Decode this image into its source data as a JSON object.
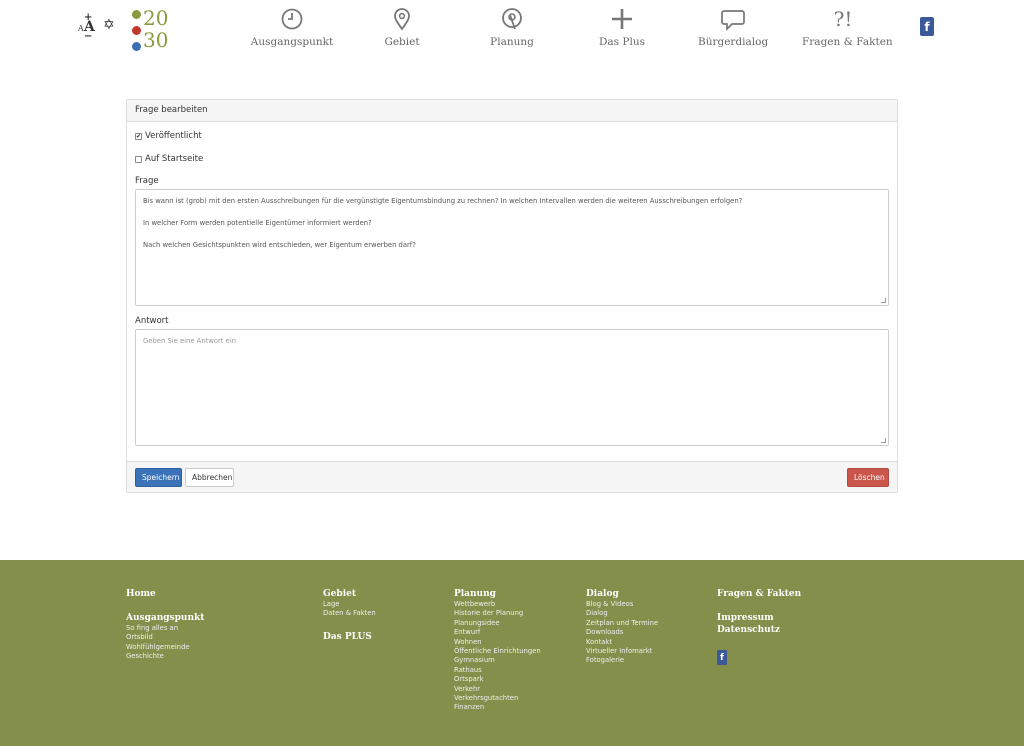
{
  "header": {
    "accessibility": {
      "plus": "+",
      "small_a": "A",
      "big_a": "A",
      "minus": "−"
    },
    "contrast_symbol": "✡",
    "logo": {
      "top": "20",
      "bottom": "30"
    },
    "nav": [
      {
        "label": "Ausgangspunkt",
        "icon": "clock-icon"
      },
      {
        "label": "Gebiet",
        "icon": "map-pin-icon"
      },
      {
        "label": "Planung",
        "icon": "compass-icon"
      },
      {
        "label": "Das Plus",
        "icon": "plus-icon"
      },
      {
        "label": "Bürgerdialog",
        "icon": "speech-bubble-icon"
      },
      {
        "label": "Fragen & Fakten",
        "icon": "question-exclamation-icon",
        "glyph": "?!"
      }
    ],
    "facebook": "f"
  },
  "form": {
    "heading": "Frage bearbeiten",
    "published": {
      "label": "Veröffentlicht",
      "checked": true,
      "mark": "✔"
    },
    "homepage": {
      "label": "Auf Startseite",
      "checked": false
    },
    "question": {
      "label": "Frage",
      "lines": [
        "Bis wann ist (grob) mit den ersten Ausschreibungen für die vergünstigte Eigentumsbindung zu rechnen? In welchen Intervallen werden die weiteren Ausschreibungen erfolgen?",
        "In welcher Form werden potentielle Eigentümer informiert werden?",
        "Nach welchen Gesichtspunkten wird entschieden, wer Eigentum erwerben darf?"
      ]
    },
    "answer": {
      "label": "Antwort",
      "placeholder": "Geben Sie eine Antwort ein"
    },
    "buttons": {
      "save": "Speichern",
      "cancel": "Abbrechen",
      "delete": "Löschen"
    }
  },
  "footer": {
    "col1": {
      "home": "Home",
      "title": "Ausgangspunkt",
      "links": [
        "So fing alles an",
        "Ortsbild",
        "Wohlfühlgemeinde",
        "Geschichte"
      ]
    },
    "col2": {
      "title": "Gebiet",
      "links": [
        "Lage",
        "Daten & Fakten"
      ],
      "plus": "Das PLUS"
    },
    "col3": {
      "title": "Planung",
      "links": [
        "Wettbewerb",
        "Historie der Planung",
        "Planungsidee",
        "Entwurf",
        "Wohnen",
        "Öffentliche Einrichtungen",
        "Gymnasium",
        "Rathaus",
        "Ortspark",
        "Verkehr",
        "Verkehrsgutachten",
        "Finanzen"
      ]
    },
    "col4": {
      "title": "Dialog",
      "links": [
        "Blog & Videos",
        "Dialog",
        "Zeitplan und Termine",
        "Downloads",
        "Kontakt",
        "Virtueller Infomarkt",
        "Fotogalerie"
      ]
    },
    "col5": {
      "title": "Fragen & Fakten",
      "impressum": "Impressum",
      "datenschutz": "Datenschutz",
      "facebook": "f"
    }
  }
}
